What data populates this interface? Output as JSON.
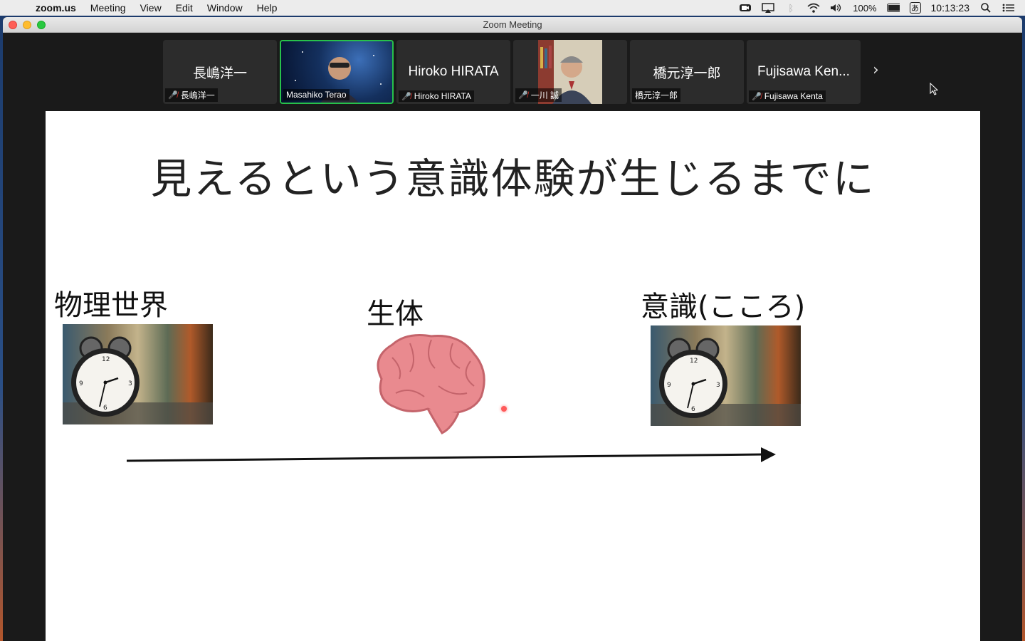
{
  "menubar": {
    "app_name": "zoom.us",
    "menus": [
      "Meeting",
      "View",
      "Edit",
      "Window",
      "Help"
    ],
    "battery": "100%",
    "input_method": "あ",
    "clock": "10:13:23"
  },
  "window": {
    "title": "Zoom Meeting"
  },
  "participants": [
    {
      "display_name": "長嶋洋一",
      "label": "長嶋洋一",
      "muted": true,
      "video": false,
      "active": false
    },
    {
      "display_name": "",
      "label": "Masahiko Terao",
      "muted": false,
      "video": true,
      "active": true
    },
    {
      "display_name": "Hiroko HIRATA",
      "label": "Hiroko HIRATA",
      "muted": true,
      "video": false,
      "active": false
    },
    {
      "display_name": "",
      "label": "一川 誠",
      "muted": true,
      "video": true,
      "active": false
    },
    {
      "display_name": "橋元淳一郎",
      "label": "橋元淳一郎",
      "muted": false,
      "video": false,
      "active": false
    },
    {
      "display_name": "Fujisawa Ken...",
      "label": "Fujisawa Kenta",
      "muted": true,
      "video": false,
      "active": false
    }
  ],
  "slide": {
    "title": "見えるという意識体験が生じるまでに",
    "labels": {
      "physical": "物理世界",
      "body": "生体",
      "mind": "意識(こころ)"
    }
  },
  "colors": {
    "active_border": "#27c14b",
    "mute_icon": "#e0332a",
    "brain": "#e98a8f"
  }
}
